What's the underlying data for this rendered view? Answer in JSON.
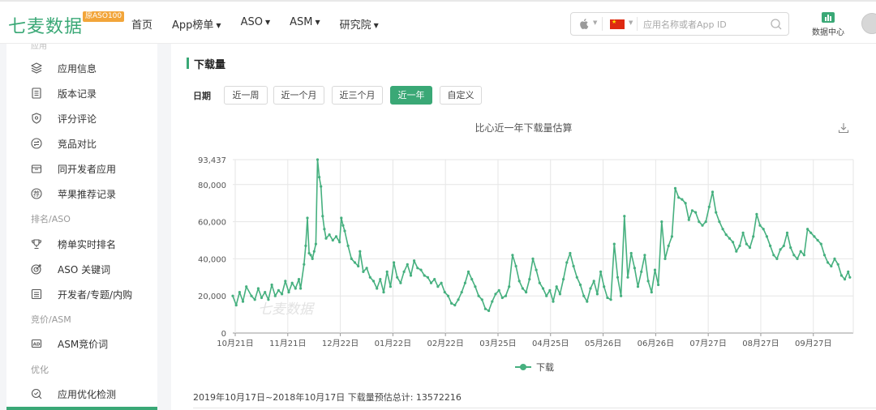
{
  "brand": {
    "logo": "七麦数据",
    "badge": "原ASO100"
  },
  "nav": {
    "items": [
      {
        "label": "首页",
        "dropdown": false
      },
      {
        "label": "App榜单",
        "dropdown": true
      },
      {
        "label": "ASO",
        "dropdown": true
      },
      {
        "label": "ASM",
        "dropdown": true
      },
      {
        "label": "研究院",
        "dropdown": true
      }
    ]
  },
  "search": {
    "placeholder": "应用名称或者App ID",
    "platform_icon": "apple-icon",
    "country_icon": "china-flag-icon"
  },
  "data_center": {
    "label": "数据中心",
    "icon": "bar-chart-icon"
  },
  "sidebar": {
    "cut_group": "应用",
    "items": [
      {
        "label": "应用信息",
        "icon": "layers-icon"
      },
      {
        "label": "版本记录",
        "icon": "document-icon"
      },
      {
        "label": "评分评论",
        "icon": "shield-star-icon"
      },
      {
        "label": "竞品对比",
        "icon": "compare-icon"
      },
      {
        "label": "同开发者应用",
        "icon": "briefcase-icon"
      },
      {
        "label": "苹果推荐记录",
        "icon": "recommend-icon"
      }
    ],
    "group_rank": "排名/ASO",
    "items_rank": [
      {
        "label": "榜单实时排名",
        "icon": "trophy-icon"
      },
      {
        "label": "ASO 关键词",
        "icon": "target-icon"
      },
      {
        "label": "开发者/专题/内购",
        "icon": "list-icon"
      }
    ],
    "group_bid": "竞价/ASM",
    "items_bid": [
      {
        "label": "ASM竞价词",
        "icon": "ad-icon"
      }
    ],
    "group_opt": "优化",
    "items_opt": [
      {
        "label": "应用优化检测",
        "icon": "check-search-icon"
      }
    ]
  },
  "main": {
    "section_title": "下载量",
    "date_label": "日期",
    "ranges": [
      "近一周",
      "近一个月",
      "近三个月",
      "近一年",
      "自定义"
    ],
    "active_range": "近一年",
    "watermark": "七麦数据",
    "footer": "2019年10月17日~2018年10月17日 下载量预估总计: 13572216"
  },
  "colors": {
    "accent": "#3aa876",
    "line": "#46b07f"
  },
  "chart_data": {
    "type": "line",
    "title": "比心近一年下载量估算",
    "x_tick_labels": [
      "10月21日",
      "11月21日",
      "12月22日",
      "01月22日",
      "02月22日",
      "03月25日",
      "04月25日",
      "05月26日",
      "06月26日",
      "07月27日",
      "08月27日",
      "09月27日"
    ],
    "y_tick_labels": [
      "0",
      "20,000",
      "40,000",
      "60,000",
      "80,000",
      "93,437"
    ],
    "ylim": [
      0,
      93437
    ],
    "xlim_days": [
      0,
      366
    ],
    "legend": [
      "下载"
    ],
    "legend_position": "bottom",
    "grid": true,
    "series": [
      {
        "name": "下载",
        "anchors": [
          [
            0,
            20000
          ],
          [
            2,
            15000
          ],
          [
            4,
            22000
          ],
          [
            6,
            17000
          ],
          [
            8,
            25000
          ],
          [
            11,
            20000
          ],
          [
            13,
            18000
          ],
          [
            15,
            24000
          ],
          [
            17,
            19000
          ],
          [
            19,
            22000
          ],
          [
            21,
            18000
          ],
          [
            23,
            26000
          ],
          [
            25,
            20000
          ],
          [
            27,
            23000
          ],
          [
            29,
            21000
          ],
          [
            31,
            28000
          ],
          [
            33,
            22000
          ],
          [
            35,
            27000
          ],
          [
            37,
            24000
          ],
          [
            39,
            29000
          ],
          [
            40,
            24000
          ],
          [
            42,
            37000
          ],
          [
            43,
            47000
          ],
          [
            44,
            62000
          ],
          [
            45,
            43000
          ],
          [
            46,
            42000
          ],
          [
            47,
            40000
          ],
          [
            48,
            44000
          ],
          [
            49,
            48000
          ],
          [
            50,
            93437
          ],
          [
            51,
            84000
          ],
          [
            52,
            79000
          ],
          [
            53,
            63000
          ],
          [
            54,
            56000
          ],
          [
            55,
            51000
          ],
          [
            57,
            53000
          ],
          [
            59,
            50000
          ],
          [
            61,
            52000
          ],
          [
            63,
            49000
          ],
          [
            64,
            62000
          ],
          [
            65,
            58000
          ],
          [
            66,
            55000
          ],
          [
            68,
            47000
          ],
          [
            70,
            40000
          ],
          [
            72,
            38000
          ],
          [
            74,
            36000
          ],
          [
            75,
            44000
          ],
          [
            77,
            33000
          ],
          [
            79,
            35000
          ],
          [
            81,
            30000
          ],
          [
            83,
            28000
          ],
          [
            85,
            24000
          ],
          [
            87,
            29000
          ],
          [
            89,
            22000
          ],
          [
            91,
            33000
          ],
          [
            93,
            25000
          ],
          [
            95,
            38000
          ],
          [
            97,
            30000
          ],
          [
            99,
            27000
          ],
          [
            101,
            33000
          ],
          [
            103,
            37000
          ],
          [
            105,
            31000
          ],
          [
            107,
            39000
          ],
          [
            109,
            35000
          ],
          [
            111,
            34000
          ],
          [
            113,
            31000
          ],
          [
            115,
            30000
          ],
          [
            117,
            27000
          ],
          [
            119,
            29000
          ],
          [
            121,
            25000
          ],
          [
            123,
            27000
          ],
          [
            125,
            22000
          ],
          [
            127,
            20000
          ],
          [
            129,
            16000
          ],
          [
            131,
            15000
          ],
          [
            133,
            18000
          ],
          [
            135,
            22000
          ],
          [
            137,
            27000
          ],
          [
            139,
            33000
          ],
          [
            141,
            29000
          ],
          [
            143,
            25000
          ],
          [
            145,
            20000
          ],
          [
            147,
            18000
          ],
          [
            149,
            13000
          ],
          [
            151,
            12000
          ],
          [
            153,
            17000
          ],
          [
            155,
            21000
          ],
          [
            157,
            23000
          ],
          [
            159,
            19000
          ],
          [
            161,
            20000
          ],
          [
            163,
            25000
          ],
          [
            165,
            42000
          ],
          [
            167,
            36000
          ],
          [
            169,
            28000
          ],
          [
            171,
            24000
          ],
          [
            173,
            22000
          ],
          [
            175,
            29000
          ],
          [
            177,
            40000
          ],
          [
            179,
            34000
          ],
          [
            181,
            27000
          ],
          [
            183,
            24000
          ],
          [
            185,
            20000
          ],
          [
            187,
            23000
          ],
          [
            189,
            17000
          ],
          [
            191,
            25000
          ],
          [
            193,
            21000
          ],
          [
            195,
            29000
          ],
          [
            197,
            38000
          ],
          [
            199,
            43000
          ],
          [
            201,
            36000
          ],
          [
            203,
            30000
          ],
          [
            205,
            26000
          ],
          [
            207,
            20000
          ],
          [
            209,
            17000
          ],
          [
            211,
            24000
          ],
          [
            213,
            28000
          ],
          [
            215,
            21000
          ],
          [
            217,
            33000
          ],
          [
            219,
            25000
          ],
          [
            221,
            19000
          ],
          [
            223,
            18000
          ],
          [
            225,
            48000
          ],
          [
            227,
            30000
          ],
          [
            229,
            20000
          ],
          [
            231,
            63000
          ],
          [
            233,
            30000
          ],
          [
            235,
            43000
          ],
          [
            237,
            35000
          ],
          [
            239,
            25000
          ],
          [
            241,
            33000
          ],
          [
            243,
            42000
          ],
          [
            245,
            28000
          ],
          [
            247,
            22000
          ],
          [
            249,
            34000
          ],
          [
            251,
            26000
          ],
          [
            253,
            60000
          ],
          [
            255,
            40000
          ],
          [
            257,
            47000
          ],
          [
            259,
            52000
          ],
          [
            261,
            78000
          ],
          [
            263,
            73000
          ],
          [
            265,
            72000
          ],
          [
            267,
            70000
          ],
          [
            269,
            61000
          ],
          [
            271,
            66000
          ],
          [
            273,
            65000
          ],
          [
            275,
            60000
          ],
          [
            277,
            58000
          ],
          [
            279,
            60000
          ],
          [
            281,
            68000
          ],
          [
            283,
            76000
          ],
          [
            285,
            65000
          ],
          [
            287,
            60000
          ],
          [
            289,
            56000
          ],
          [
            291,
            53000
          ],
          [
            293,
            51000
          ],
          [
            295,
            49000
          ],
          [
            297,
            44000
          ],
          [
            299,
            47000
          ],
          [
            301,
            54000
          ],
          [
            303,
            48000
          ],
          [
            305,
            46000
          ],
          [
            307,
            52000
          ],
          [
            309,
            64000
          ],
          [
            311,
            58000
          ],
          [
            313,
            56000
          ],
          [
            315,
            52000
          ],
          [
            317,
            47000
          ],
          [
            319,
            42000
          ],
          [
            321,
            40000
          ],
          [
            323,
            45000
          ],
          [
            325,
            47000
          ],
          [
            327,
            54000
          ],
          [
            329,
            46000
          ],
          [
            331,
            42000
          ],
          [
            333,
            40000
          ],
          [
            335,
            44000
          ],
          [
            337,
            42000
          ],
          [
            339,
            56000
          ],
          [
            341,
            54000
          ],
          [
            343,
            52000
          ],
          [
            345,
            50000
          ],
          [
            347,
            48000
          ],
          [
            349,
            42000
          ],
          [
            351,
            38000
          ],
          [
            353,
            36000
          ],
          [
            355,
            40000
          ],
          [
            357,
            37000
          ],
          [
            359,
            31000
          ],
          [
            361,
            29000
          ],
          [
            363,
            33000
          ],
          [
            364,
            30000
          ]
        ]
      }
    ]
  }
}
